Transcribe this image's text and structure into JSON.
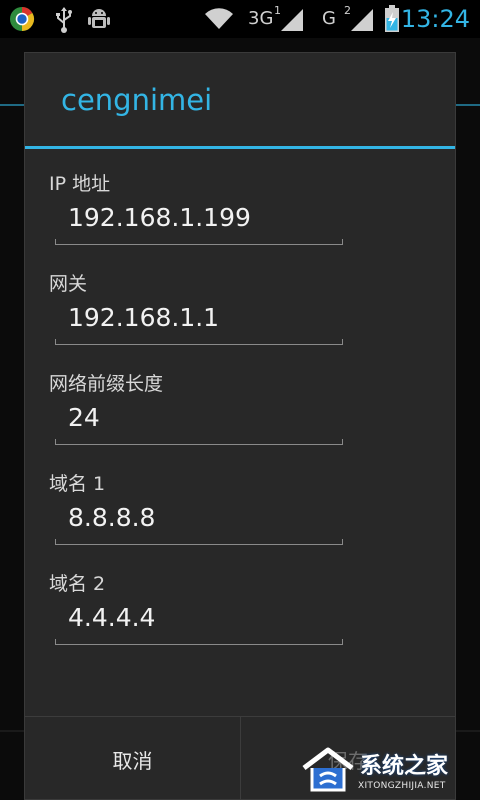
{
  "status_bar": {
    "icons": [
      "chrome-like-app-icon",
      "usb-icon",
      "android-debug-icon",
      "wifi-icon",
      "signal-3g-icon",
      "signal-g-icon",
      "battery-charging-icon"
    ],
    "net1_label": "3G",
    "net1_sim": "1",
    "net2_label": "G",
    "net2_sim": "2",
    "time": "13:24",
    "accent_color": "#33b5e5"
  },
  "dialog": {
    "title": "cengnimei",
    "fields": [
      {
        "label": "IP 地址",
        "value": "192.168.1.199"
      },
      {
        "label": "网关",
        "value": "192.168.1.1"
      },
      {
        "label": "网络前缀长度",
        "value": "24"
      },
      {
        "label": "域名 1",
        "value": "8.8.8.8"
      },
      {
        "label": "域名 2",
        "value": "4.4.4.4"
      }
    ],
    "buttons": {
      "cancel": "取消",
      "save": "保存"
    }
  },
  "watermark": {
    "text": "系统之家",
    "url": "XITONGZHIJIA.NET"
  }
}
